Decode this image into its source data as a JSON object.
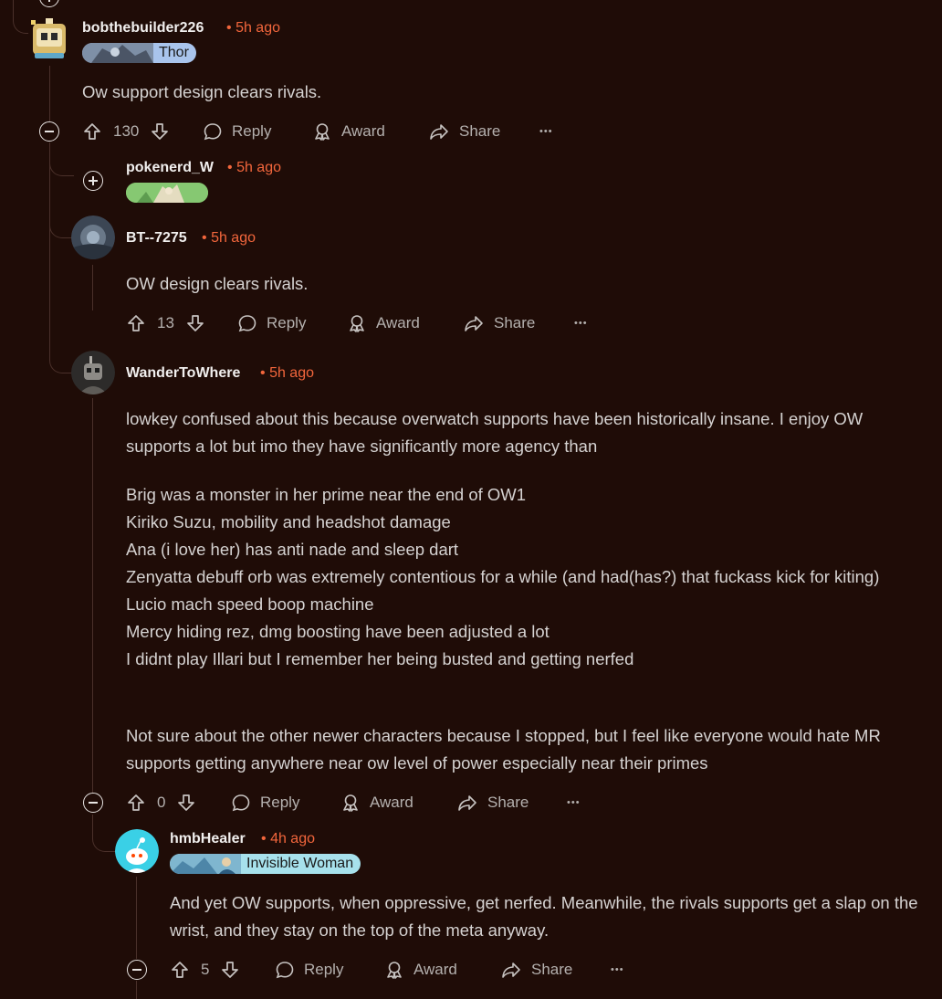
{
  "comments": [
    {
      "username": "bobthebuilder226",
      "time": "5h ago",
      "flair": "Thor",
      "body": "Ow support design clears rivals.",
      "score": "130"
    },
    {
      "username": "pokenerd_W",
      "time": "5h ago"
    },
    {
      "username": "BT--7275",
      "time": "5h ago",
      "body": "OW design clears rivals.",
      "score": "13"
    },
    {
      "username": "WanderToWhere",
      "time": "5h ago",
      "body_p1": "lowkey confused about this because overwatch supports have been historically insane. I enjoy OW supports a lot but imo they have significantly more agency than",
      "body_p2": "Brig was a monster in her prime near the end of OW1\nKiriko Suzu, mobility and headshot damage\nAna (i love her) has anti nade and sleep dart\nZenyatta debuff orb was extremely contentious for a while (and had(has?) that fuckass kick for kiting)\nLucio mach speed boop machine\nMercy hiding rez, dmg boosting have been adjusted a lot\nI didnt play Illari but I remember her being busted and getting nerfed",
      "body_p3": "Not sure about the other newer characters because I stopped, but I feel like everyone would hate MR supports getting anywhere near ow level of power especially near their primes",
      "score": "0"
    },
    {
      "username": "hmbHealer",
      "time": "4h ago",
      "flair": "Invisible Woman",
      "body": "And yet OW supports, when oppressive, get nerfed. Meanwhile, the rivals supports get a slap on the wrist, and they stay on the top of the meta anyway.",
      "score": "5"
    }
  ],
  "actions": {
    "reply": "Reply",
    "award": "Award",
    "share": "Share",
    "more": "•••"
  },
  "separator": "•",
  "colors": {
    "background": "#1f0c07",
    "timestamp": "#f2663c",
    "thor_flair": "#a9c4ec",
    "invisible_woman_flair": "#a7e1ec",
    "pokenerd_flair": "#7cc66c"
  }
}
